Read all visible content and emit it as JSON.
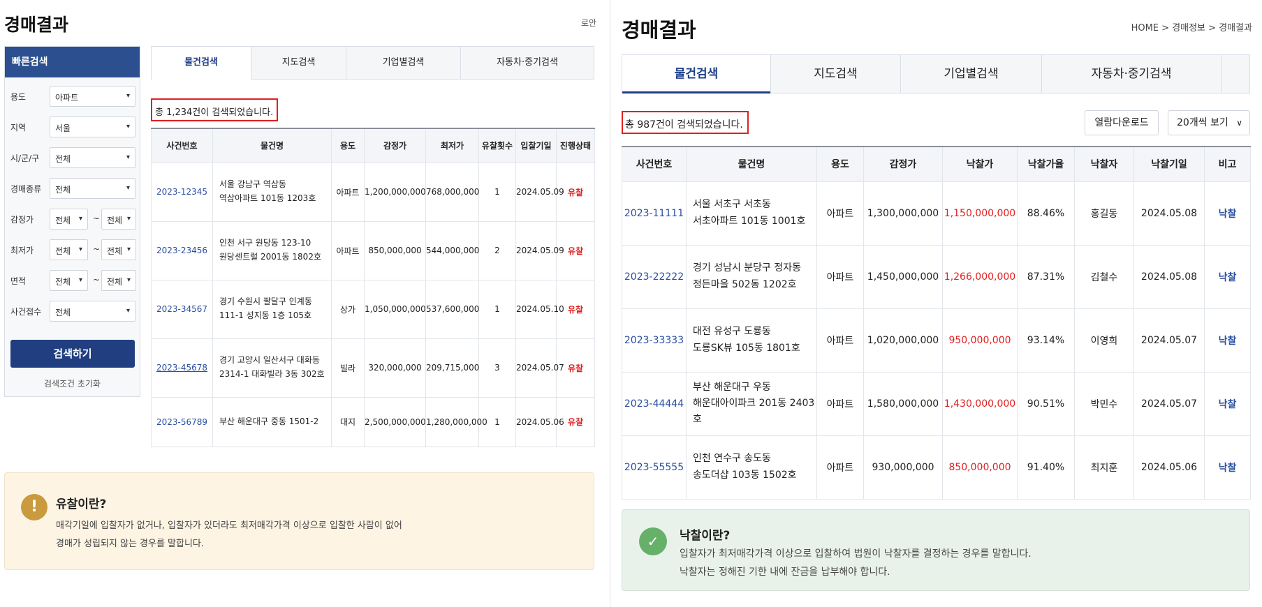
{
  "left": {
    "title": "경매결과",
    "breadcrumb": "로안",
    "quick_search": {
      "title": "빠른검색",
      "rows": [
        {
          "label": "용도",
          "value": "아파트"
        },
        {
          "label": "지역",
          "value": "서울"
        },
        {
          "label": "시/군/구",
          "value": "전체"
        },
        {
          "label": "경매종류",
          "value": "전체"
        },
        {
          "label": "감정가",
          "from": "전체",
          "to": "전체"
        },
        {
          "label": "최저가",
          "from": "전체",
          "to": "전체"
        },
        {
          "label": "면적",
          "from": "전체",
          "to": "전체"
        },
        {
          "label": "사건접수",
          "value": "전체"
        }
      ],
      "tilde": "~",
      "search_button": "검색하기",
      "reset_link": "검색조건 초기화"
    },
    "tabs": [
      "물건검색",
      "지도검색",
      "기업별검색",
      "자동차·중기검색"
    ],
    "count_text": "총 1,234건이 검색되었습니다.",
    "table": {
      "headers": [
        "사건번호",
        "물건명",
        "용도",
        "감정가",
        "최저가",
        "유찰횟수",
        "입찰기일",
        "진행상태"
      ],
      "rows": [
        {
          "case": "2023-12345",
          "name1": "서울 강남구 역삼동",
          "name2": "역삼아파트 101동 1203호",
          "use": "아파트",
          "appraisal": "1,200,000,000",
          "minimum": "768,000,000",
          "fails": "1",
          "date": "2024.05.09",
          "status": "유찰"
        },
        {
          "case": "2023-23456",
          "name1": "인천 서구 원당동 123-10",
          "name2": "원당센트럴 2001동 1802호",
          "use": "아파트",
          "appraisal": "850,000,000",
          "minimum": "544,000,000",
          "fails": "2",
          "date": "2024.05.09",
          "status": "유찰"
        },
        {
          "case": "2023-34567",
          "name1": "경기 수원시 팔달구 인계동",
          "name2": "111-1 성지동 1층 105호",
          "use": "상가",
          "appraisal": "1,050,000,000",
          "minimum": "537,600,000",
          "fails": "1",
          "date": "2024.05.10",
          "status": "유찰"
        },
        {
          "case": "2023-45678",
          "name1": "경기 고양시 일산서구 대화동",
          "name2": "2314-1 대화빌라 3동 302호",
          "use": "빌라",
          "appraisal": "320,000,000",
          "minimum": "209,715,000",
          "fails": "3",
          "date": "2024.05.07",
          "status": "유찰"
        },
        {
          "case": "2023-56789",
          "name1": "부산 해운대구 중동 1501-2",
          "name2": "",
          "use": "대지",
          "appraisal": "2,500,000,000",
          "minimum": "1,280,000,000",
          "fails": "1",
          "date": "2024.05.06",
          "status": "유찰"
        }
      ]
    },
    "info": {
      "icon": "!",
      "title": "유찰이란?",
      "line1": "매각기일에 입찰자가 없거나, 입찰자가 있더라도 최저매각가격 이상으로 입찰한 사람이 없어",
      "line2": "경매가 성립되지 않는 경우를 말합니다."
    }
  },
  "right": {
    "title": "경매결과",
    "breadcrumb": "HOME > 경매정보 > 경매결과",
    "tabs": [
      "물건검색",
      "지도검색",
      "기업별검색",
      "자동차·중기검색"
    ],
    "count_text": "총 987건이 검색되었습니다.",
    "download_button": "열람다운로드",
    "page_size": "20개씩 보기",
    "table": {
      "headers": [
        "사건번호",
        "물건명",
        "용도",
        "감정가",
        "낙찰가",
        "낙찰가율",
        "낙찰자",
        "낙찰기일",
        "비고"
      ],
      "rows": [
        {
          "case": "2023-11111",
          "name1": "서울 서초구 서초동",
          "name2": "서초아파트 101동 1001호",
          "use": "아파트",
          "appraisal": "1,300,000,000",
          "winning": "1,150,000,000",
          "rate": "88.46%",
          "winner": "홍길동",
          "date": "2024.05.08",
          "note": "낙찰"
        },
        {
          "case": "2023-22222",
          "name1": "경기 성남시 분당구 정자동",
          "name2": "정든마을 502동 1202호",
          "use": "아파트",
          "appraisal": "1,450,000,000",
          "winning": "1,266,000,000",
          "rate": "87.31%",
          "winner": "김철수",
          "date": "2024.05.08",
          "note": "낙찰"
        },
        {
          "case": "2023-33333",
          "name1": "대전 유성구 도룡동",
          "name2": "도룡SK뷰 105동 1801호",
          "use": "아파트",
          "appraisal": "1,020,000,000",
          "winning": "950,000,000",
          "rate": "93.14%",
          "winner": "이영희",
          "date": "2024.05.07",
          "note": "낙찰"
        },
        {
          "case": "2023-44444",
          "name1": "부산 해운대구 우동",
          "name2": "해운대아이파크 201동 2403호",
          "use": "아파트",
          "appraisal": "1,580,000,000",
          "winning": "1,430,000,000",
          "rate": "90.51%",
          "winner": "박민수",
          "date": "2024.05.07",
          "note": "낙찰"
        },
        {
          "case": "2023-55555",
          "name1": "인천 연수구 송도동",
          "name2": "송도더샵 103동 1502호",
          "use": "아파트",
          "appraisal": "930,000,000",
          "winning": "850,000,000",
          "rate": "91.40%",
          "winner": "최지훈",
          "date": "2024.05.06",
          "note": "낙찰"
        }
      ]
    },
    "info": {
      "icon": "✓",
      "title": "낙찰이란?",
      "line1": "입찰자가 최저매각가격 이상으로 입찰하여 법원이 낙찰자를 결정하는 경우를 말합니다.",
      "line2": "낙찰자는 정해진 기한 내에 잔금을 납부해야 합니다."
    }
  },
  "colors": {
    "primary": "#213f80",
    "header_blue": "#2b4f8f",
    "link": "#2a4fa0",
    "alert_red": "#e02020",
    "warn_bg": "#fdf4e4",
    "success_bg": "#e9f2ea"
  }
}
